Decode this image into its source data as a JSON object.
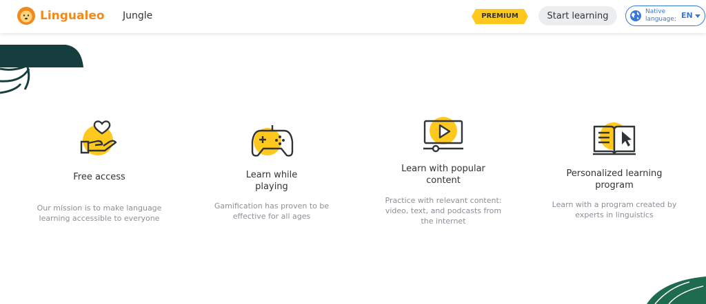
{
  "header": {
    "brand": "Lingualeo",
    "nav_link": "Jungle",
    "premium_label": "PREMIUM",
    "start_button": "Start learning",
    "language": {
      "label": "Native language:",
      "code": "EN"
    }
  },
  "features": [
    {
      "title": "Free access",
      "description": "Our mission is to make language learning accessible to everyone",
      "icon": "heart-hand-icon"
    },
    {
      "title": "Learn while playing",
      "description": "Gamification has proven to be effective for all ages",
      "icon": "gamepad-icon"
    },
    {
      "title": "Learn with popular content",
      "description": "Practice with relevant content: video, text, and podcasts from the internet",
      "icon": "video-monitor-icon"
    },
    {
      "title": "Personalized learning program",
      "description": "Learn with a program created by experts in linguistics",
      "icon": "book-icon"
    }
  ],
  "colors": {
    "accent_yellow": "#ffc81e",
    "brand_orange": "#f08a1c",
    "link_blue": "#3a78d6",
    "jungle_green": "#163e3f"
  }
}
